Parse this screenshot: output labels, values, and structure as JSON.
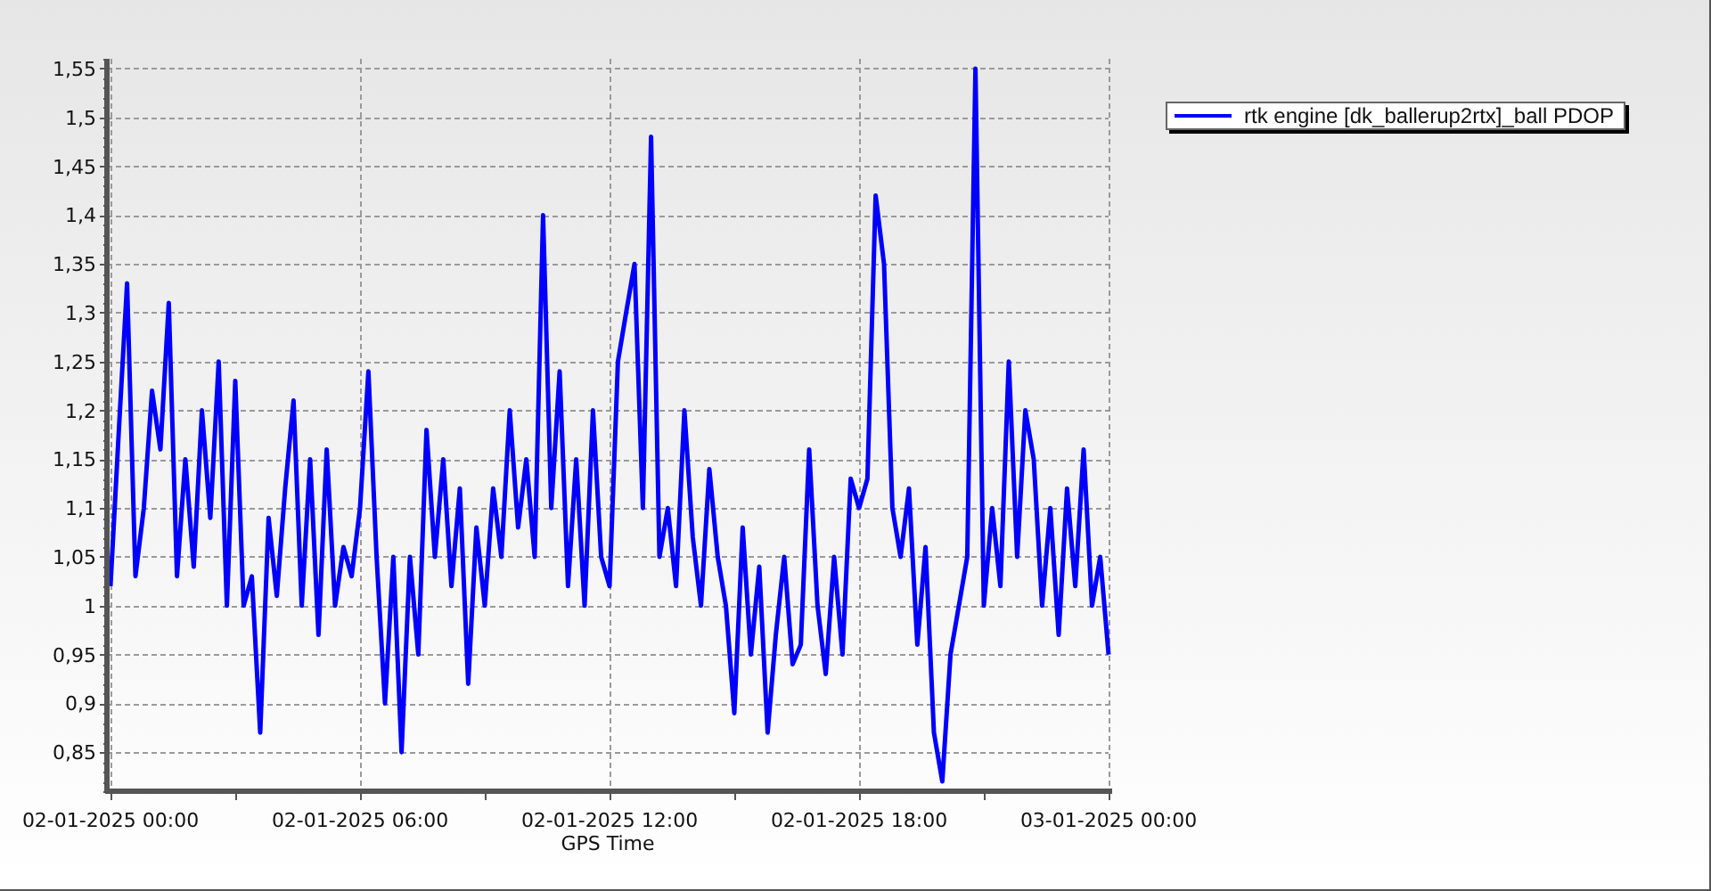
{
  "chart": {
    "chart_data": {
      "type": "line",
      "xlabel": "GPS Time",
      "grid": true,
      "ylim": [
        0.81,
        1.56
      ],
      "yticks": [
        {
          "value": 0.85,
          "label": "0,85"
        },
        {
          "value": 0.9,
          "label": "0,9"
        },
        {
          "value": 0.95,
          "label": "0,95"
        },
        {
          "value": 1,
          "label": "1"
        },
        {
          "value": 1.05,
          "label": "1,05"
        },
        {
          "value": 1.1,
          "label": "1,1"
        },
        {
          "value": 1.15,
          "label": "1,15"
        },
        {
          "value": 1.2,
          "label": "1,2"
        },
        {
          "value": 1.25,
          "label": "1,25"
        },
        {
          "value": 1.3,
          "label": "1,3"
        },
        {
          "value": 1.35,
          "label": "1,35"
        },
        {
          "value": 1.4,
          "label": "1,4"
        },
        {
          "value": 1.45,
          "label": "1,45"
        },
        {
          "value": 1.5,
          "label": "1,5"
        },
        {
          "value": 1.55,
          "label": "1,55"
        }
      ],
      "categories": [
        "02-01-2025 00:00",
        null,
        null,
        null,
        null,
        null,
        null,
        null,
        null,
        null,
        null,
        null,
        null,
        null,
        null,
        null,
        null,
        null,
        null,
        null,
        null,
        null,
        null,
        null,
        null,
        null,
        null,
        null,
        null,
        null,
        "02-01-2025 06:00",
        null,
        null,
        null,
        null,
        null,
        null,
        null,
        null,
        null,
        null,
        null,
        null,
        null,
        null,
        null,
        null,
        null,
        null,
        null,
        null,
        null,
        null,
        null,
        null,
        null,
        null,
        null,
        null,
        null,
        "02-01-2025 12:00",
        null,
        null,
        null,
        null,
        null,
        null,
        null,
        null,
        null,
        null,
        null,
        null,
        null,
        null,
        null,
        null,
        null,
        null,
        null,
        null,
        null,
        null,
        null,
        null,
        null,
        null,
        null,
        null,
        null,
        "02-01-2025 18:00",
        null,
        null,
        null,
        null,
        null,
        null,
        null,
        null,
        null,
        null,
        null,
        null,
        null,
        null,
        null,
        null,
        null,
        null,
        null,
        null,
        null,
        null,
        null,
        null,
        null,
        null,
        null,
        null,
        null,
        "03-01-2025 00:00"
      ],
      "series": [
        {
          "name": "rtk engine [dk_ballerup2rtx]_ball PDOP",
          "color": "#0000ff",
          "values": [
            1.02,
            1.18,
            1.33,
            1.03,
            1.1,
            1.22,
            1.16,
            1.31,
            1.03,
            1.15,
            1.04,
            1.2,
            1.09,
            1.25,
            1.0,
            1.23,
            1.0,
            1.03,
            0.87,
            1.09,
            1.01,
            1.12,
            1.21,
            1.0,
            1.15,
            0.97,
            1.16,
            1.0,
            1.06,
            1.03,
            1.1,
            1.24,
            1.05,
            0.9,
            1.05,
            0.85,
            1.05,
            0.95,
            1.18,
            1.05,
            1.15,
            1.02,
            1.12,
            0.92,
            1.08,
            1.0,
            1.12,
            1.05,
            1.2,
            1.08,
            1.15,
            1.05,
            1.4,
            1.1,
            1.24,
            1.02,
            1.15,
            1.0,
            1.2,
            1.05,
            1.02,
            1.25,
            1.3,
            1.35,
            1.1,
            1.48,
            1.05,
            1.1,
            1.02,
            1.2,
            1.07,
            1.0,
            1.14,
            1.05,
            1.0,
            0.89,
            1.08,
            0.95,
            1.04,
            0.87,
            0.97,
            1.05,
            0.94,
            0.96,
            1.16,
            1.0,
            0.93,
            1.05,
            0.95,
            1.13,
            1.1,
            1.13,
            1.42,
            1.35,
            1.1,
            1.05,
            1.12,
            0.96,
            1.06,
            0.87,
            0.82,
            0.95,
            1.0,
            1.05,
            1.55,
            1.0,
            1.1,
            1.02,
            1.25,
            1.05,
            1.2,
            1.15,
            1.0,
            1.1,
            0.97,
            1.12,
            1.02,
            1.16,
            1.0,
            1.05,
            0.95
          ]
        }
      ]
    }
  }
}
